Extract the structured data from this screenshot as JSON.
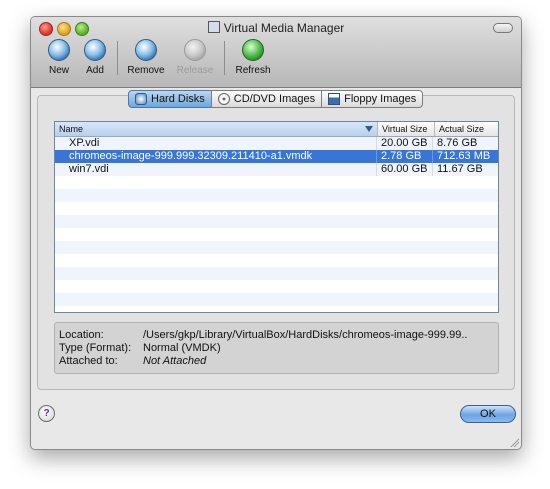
{
  "window": {
    "title": "Virtual Media Manager"
  },
  "toolbar": {
    "new": "New",
    "add": "Add",
    "remove": "Remove",
    "release": "Release",
    "refresh": "Refresh"
  },
  "tabs": [
    "Hard Disks",
    "CD/DVD Images",
    "Floppy Images"
  ],
  "table": {
    "headers": [
      "Name",
      "Virtual Size",
      "Actual Size"
    ],
    "rows": [
      {
        "name": "XP.vdi",
        "virtual": "20.00 GB",
        "actual": "8.76 GB"
      },
      {
        "name": "chromeos-image-999.999.32309.211410-a1.vmdk",
        "virtual": "2.78 GB",
        "actual": "712.63 MB"
      },
      {
        "name": "win7.vdi",
        "virtual": "60.00 GB",
        "actual": "11.67 GB"
      }
    ],
    "selected_index": 1
  },
  "details": {
    "location_label": "Location:",
    "location_value": "/Users/gkp/Library/VirtualBox/HardDisks/chromeos-image-999.99..",
    "type_label": "Type (Format):",
    "type_value": "Normal (VMDK)",
    "attached_label": "Attached to:",
    "attached_value": "Not Attached"
  },
  "buttons": {
    "help": "?",
    "ok": "OK"
  }
}
